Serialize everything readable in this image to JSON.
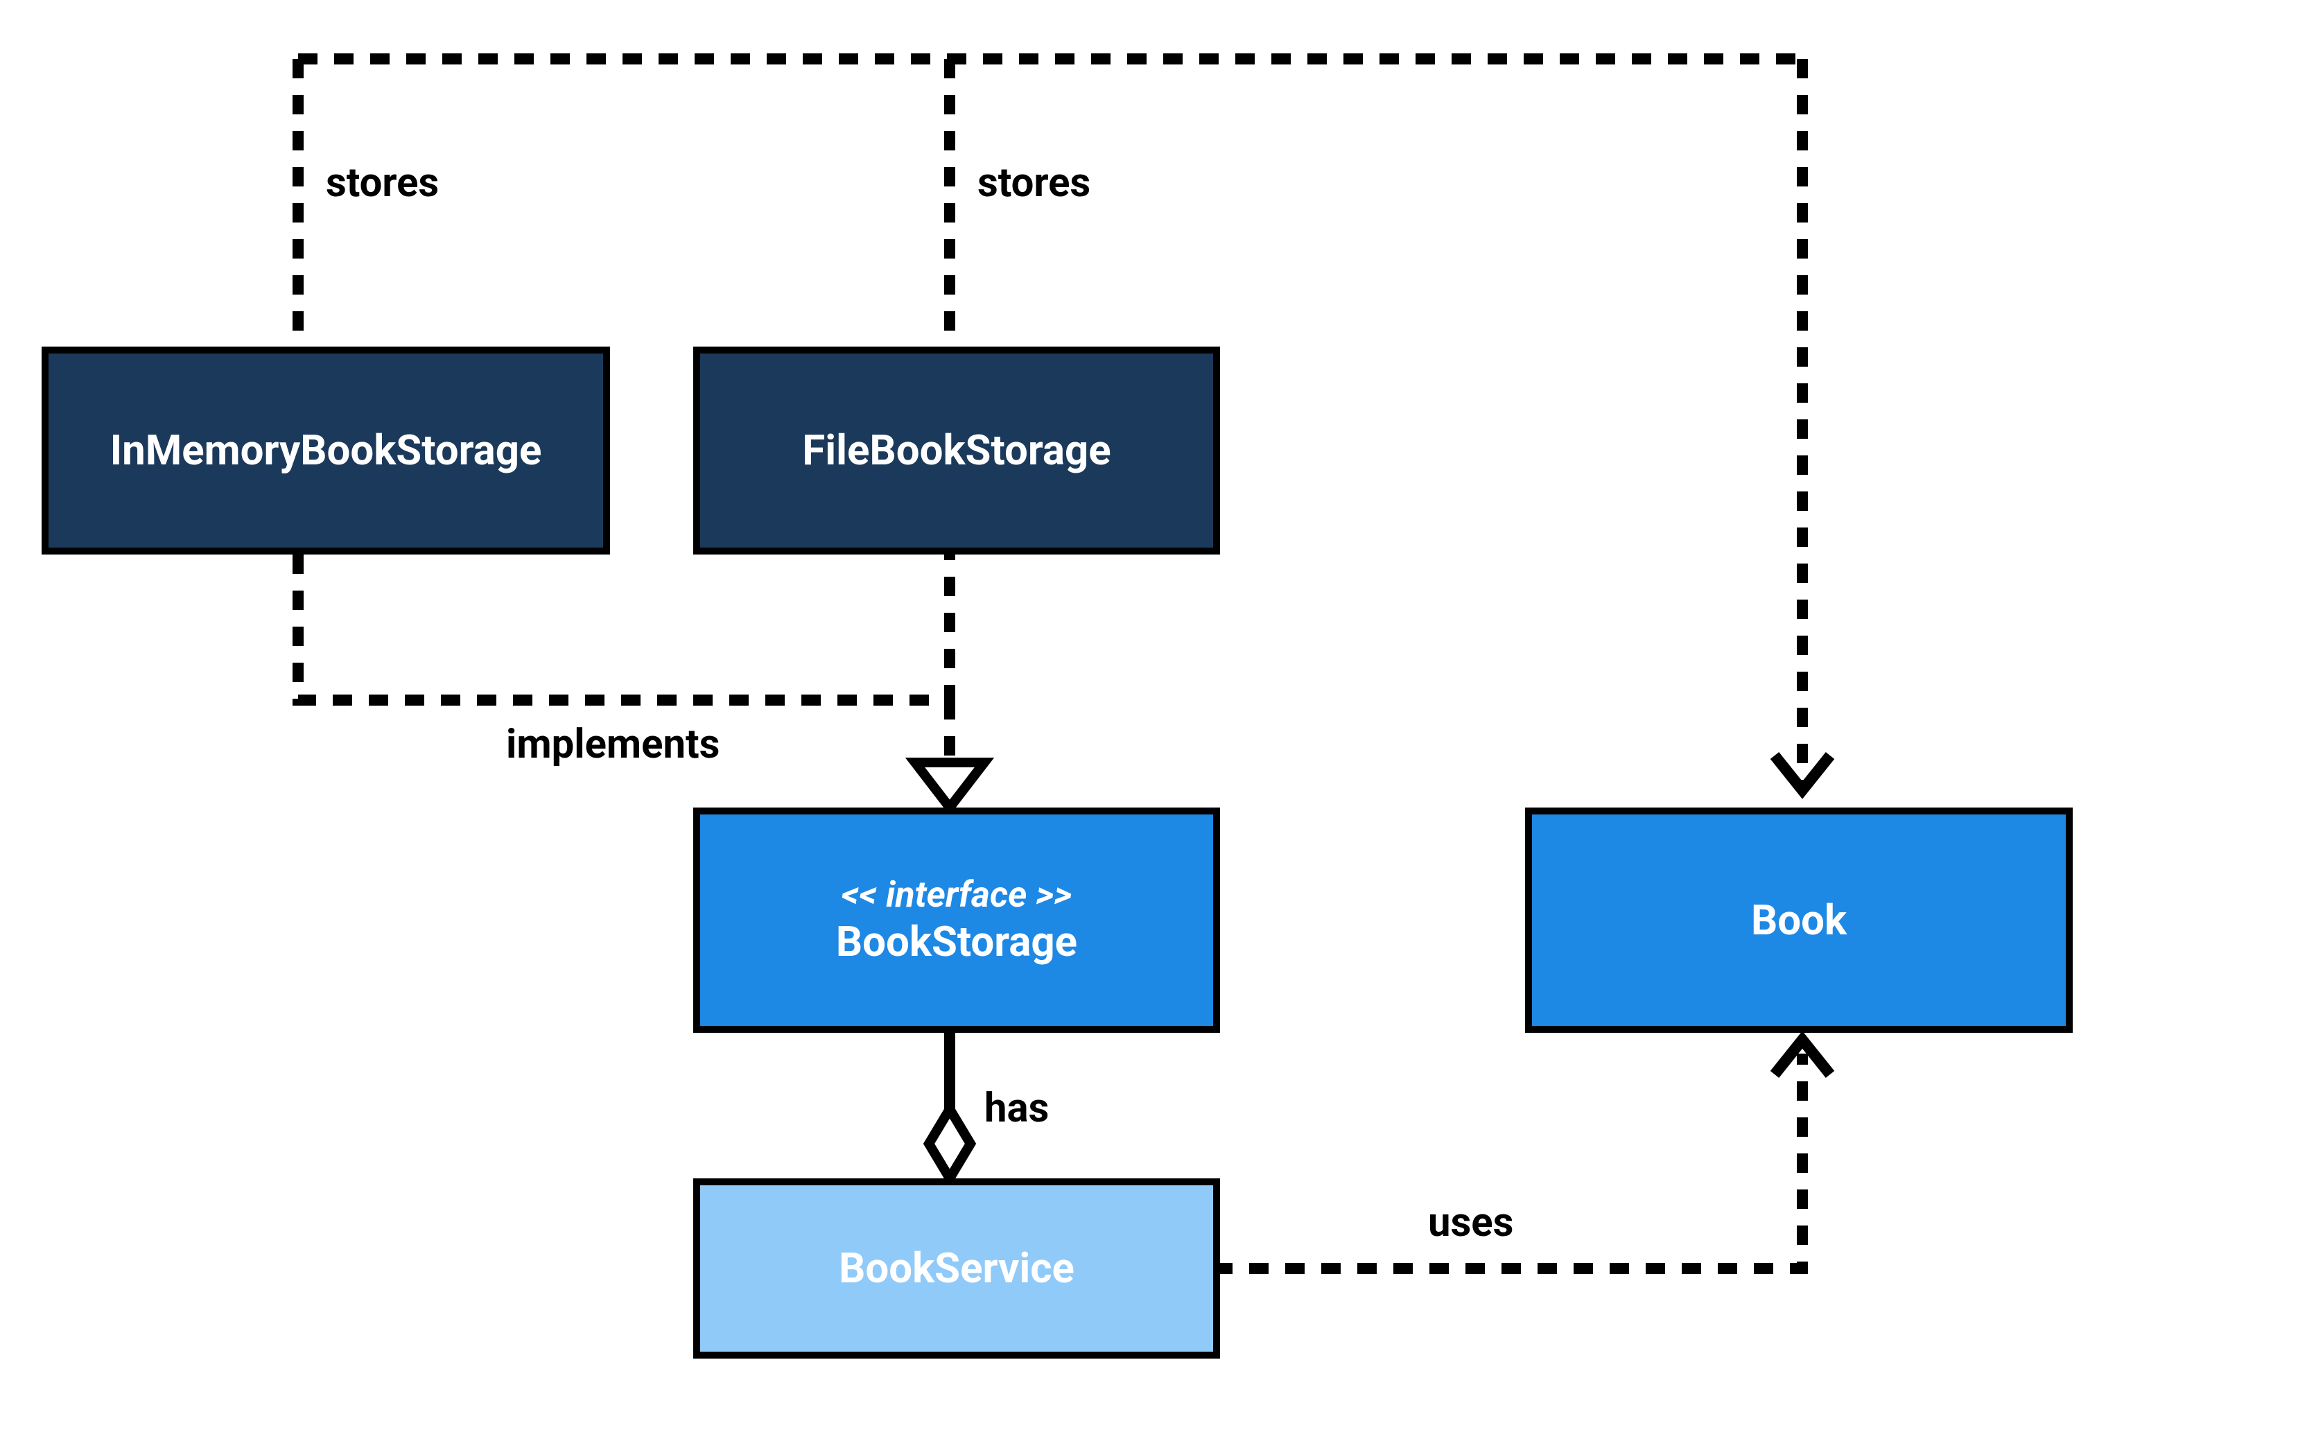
{
  "nodes": {
    "inmem": {
      "label": "InMemoryBookStorage"
    },
    "filebs": {
      "label": "FileBookStorage"
    },
    "iface": {
      "stereotype": "<< interface >>",
      "label": "BookStorage"
    },
    "book": {
      "label": "Book"
    },
    "service": {
      "label": "BookService"
    }
  },
  "edges": {
    "inmem_stores": {
      "label": "stores"
    },
    "filebs_stores": {
      "label": "stores"
    },
    "impl": {
      "label": "implements"
    },
    "has": {
      "label": "has"
    },
    "uses": {
      "label": "uses"
    }
  },
  "colors": {
    "dark": "#1b3a5b",
    "mid": "#1e88e5",
    "light": "#90caf9",
    "stroke": "#000000"
  }
}
